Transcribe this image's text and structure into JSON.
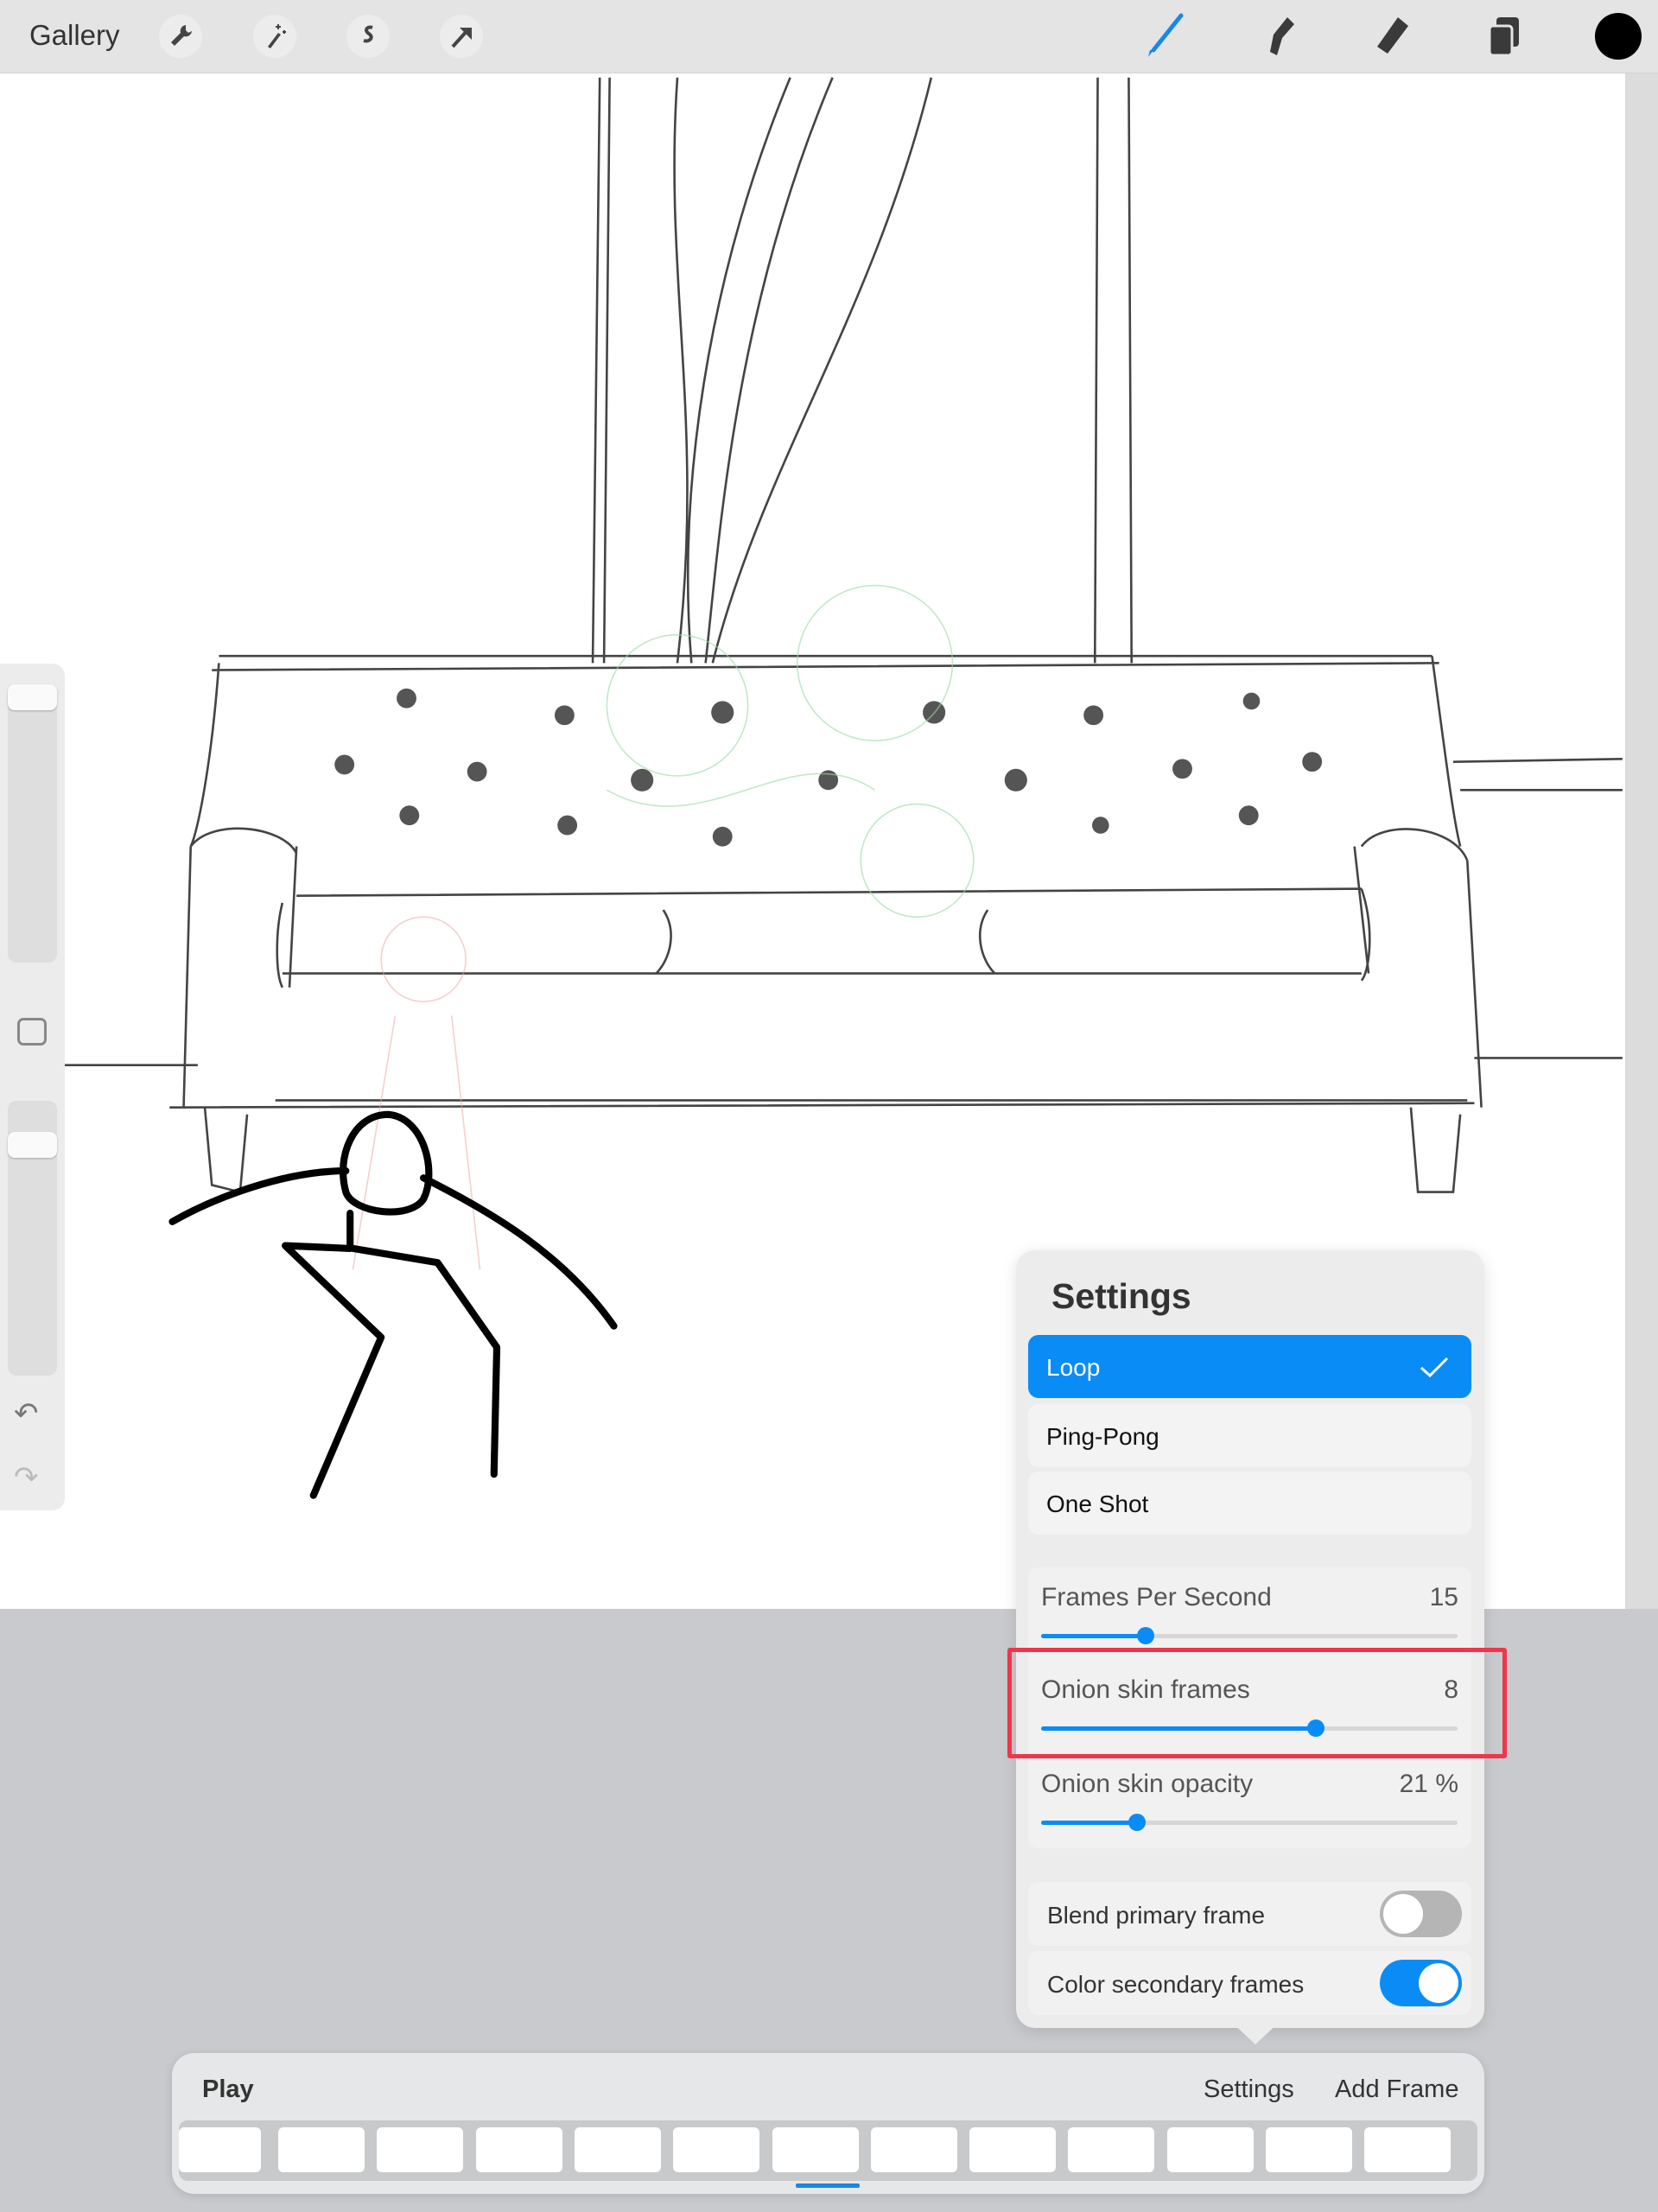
{
  "topbar": {
    "gallery_label": "Gallery",
    "left_tools": [
      "wrench-icon",
      "magic-wand-icon",
      "selection-icon",
      "transform-arrow-icon"
    ],
    "right_tools": [
      "brush-icon",
      "smudge-icon",
      "eraser-icon",
      "layers-icon",
      "color-swatch-icon"
    ],
    "active_tool": "brush-icon",
    "accent_color": "#0a8cf6",
    "current_color": "#000000"
  },
  "settings_panel": {
    "title": "Settings",
    "playback_options": [
      {
        "label": "Loop",
        "selected": true
      },
      {
        "label": "Ping-Pong",
        "selected": false
      },
      {
        "label": "One Shot",
        "selected": false
      }
    ],
    "sliders": [
      {
        "label": "Frames Per Second",
        "value": "15",
        "fraction": 0.25
      },
      {
        "label": "Onion skin frames",
        "value": "8",
        "fraction": 0.66,
        "highlighted": true
      },
      {
        "label": "Onion skin opacity",
        "value": "21 %",
        "fraction": 0.23
      }
    ],
    "toggles": [
      {
        "label": "Blend primary frame",
        "on": false
      },
      {
        "label": "Color secondary frames",
        "on": true
      }
    ],
    "highlight_color": "#f0354a"
  },
  "timeline": {
    "play_label": "Play",
    "settings_label": "Settings",
    "add_frame_label": "Add Frame",
    "frame_count": 13,
    "current_frame": 7
  }
}
